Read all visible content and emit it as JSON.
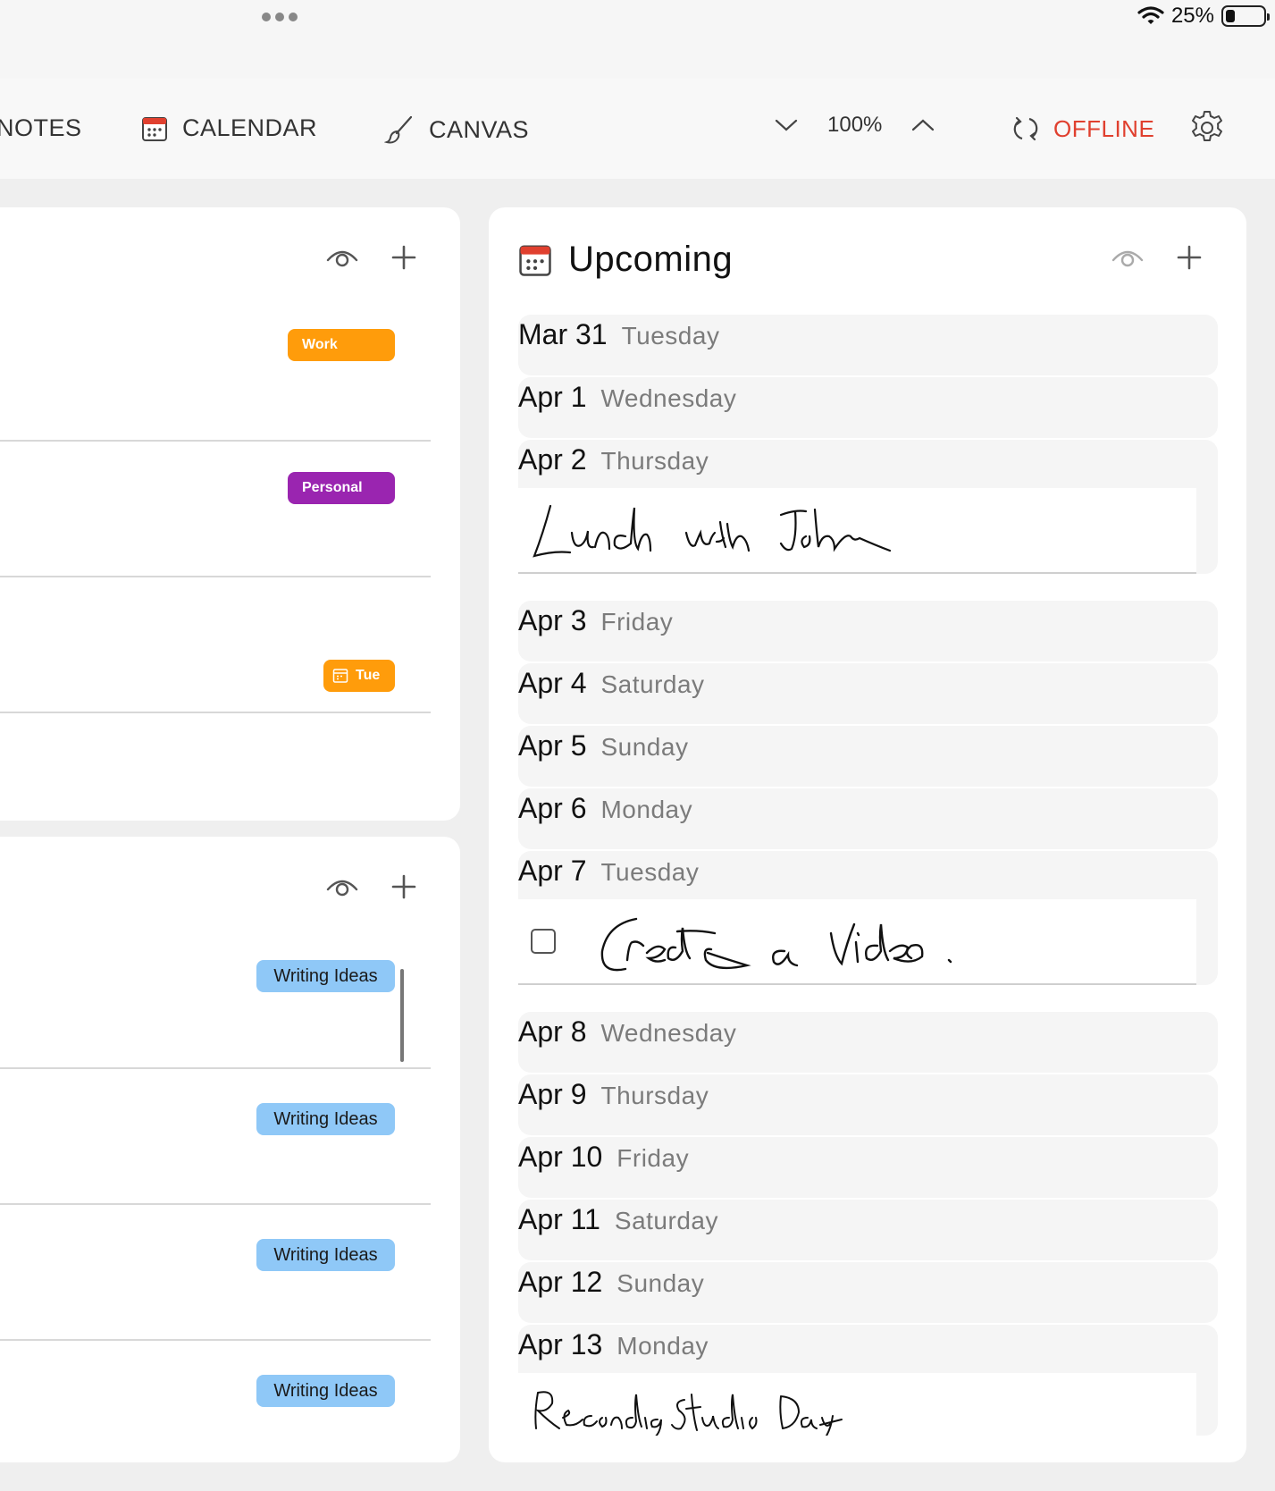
{
  "status": {
    "battery_percent": "25%",
    "battery_level": 0.25
  },
  "toolbar": {
    "tabs": [
      {
        "label": "NOTES"
      },
      {
        "label": "CALENDAR"
      },
      {
        "label": "CANVAS"
      }
    ],
    "zoom": "100%",
    "sync_status": "OFFLINE"
  },
  "left_panel_top": {
    "tags": [
      {
        "label": "Work",
        "color": "#ff9c0b"
      },
      {
        "label": "Personal",
        "color": "#9a25b0"
      },
      {
        "label": "Tue",
        "color": "#ff9c0b"
      }
    ]
  },
  "left_panel_bottom": {
    "tags": [
      {
        "label": "Writing Ideas"
      },
      {
        "label": "Writing Ideas"
      },
      {
        "label": "Writing Ideas"
      },
      {
        "label": "Writing Ideas"
      }
    ]
  },
  "upcoming": {
    "title": "Upcoming",
    "days": [
      {
        "date": "Mar 31",
        "weekday": "Tuesday"
      },
      {
        "date": "Apr 1",
        "weekday": "Wednesday"
      },
      {
        "date": "Apr 2",
        "weekday": "Thursday",
        "entry": "Lunch with John"
      },
      {
        "date": "Apr 3",
        "weekday": "Friday"
      },
      {
        "date": "Apr 4",
        "weekday": "Saturday"
      },
      {
        "date": "Apr 5",
        "weekday": "Sunday"
      },
      {
        "date": "Apr 6",
        "weekday": "Monday"
      },
      {
        "date": "Apr 7",
        "weekday": "Tuesday",
        "entry": "Create a Video."
      },
      {
        "date": "Apr 8",
        "weekday": "Wednesday"
      },
      {
        "date": "Apr 9",
        "weekday": "Thursday"
      },
      {
        "date": "Apr 10",
        "weekday": "Friday"
      },
      {
        "date": "Apr 11",
        "weekday": "Saturday"
      },
      {
        "date": "Apr 12",
        "weekday": "Sunday"
      },
      {
        "date": "Apr 13",
        "weekday": "Monday",
        "entry": "Recording Studio Day"
      }
    ]
  }
}
